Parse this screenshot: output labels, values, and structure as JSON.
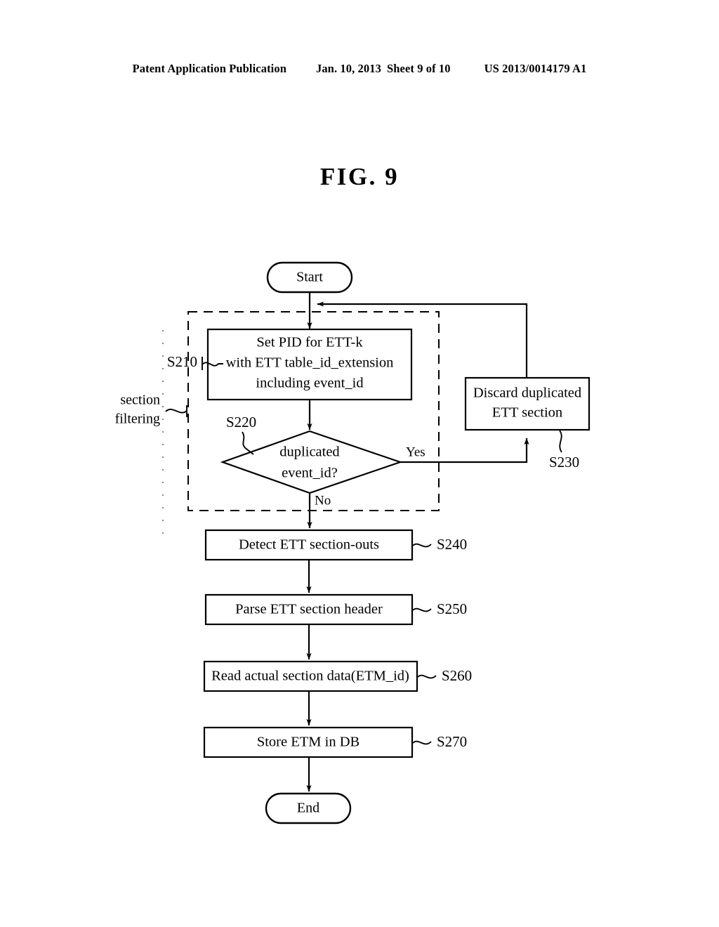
{
  "header": {
    "publication": "Patent Application Publication",
    "date": "Jan. 10, 2013",
    "sheet": "Sheet 9 of 10",
    "patent_number": "US 2013/0014179 A1"
  },
  "figure": {
    "title": "FIG. 9"
  },
  "flowchart": {
    "type": "flowchart",
    "start": "Start",
    "end": "End",
    "group_label_line1": "section",
    "group_label_line2": "filtering",
    "nodes": [
      {
        "id": "S210",
        "shape": "process",
        "ref": "S210",
        "lines": [
          "Set PID for ETT-k",
          "with ETT table_id_extension",
          "including event_id"
        ]
      },
      {
        "id": "S220",
        "shape": "decision",
        "ref": "S220",
        "lines": [
          "duplicated",
          "event_id?"
        ]
      },
      {
        "id": "S230",
        "shape": "process",
        "ref": "S230",
        "lines": [
          "Discard duplicated",
          "ETT section"
        ]
      },
      {
        "id": "S240",
        "shape": "process",
        "ref": "S240",
        "lines": [
          "Detect ETT section-outs"
        ]
      },
      {
        "id": "S250",
        "shape": "process",
        "ref": "S250",
        "lines": [
          "Parse ETT section header"
        ]
      },
      {
        "id": "S260",
        "shape": "process",
        "ref": "S260",
        "lines": [
          "Read actual section data(ETM_id)"
        ]
      },
      {
        "id": "S270",
        "shape": "process",
        "ref": "S270",
        "lines": [
          "Store ETM in DB"
        ]
      }
    ],
    "branches": {
      "yes": "Yes",
      "no": "No"
    },
    "colors": {
      "ink": "#000000",
      "paper": "#ffffff"
    }
  }
}
